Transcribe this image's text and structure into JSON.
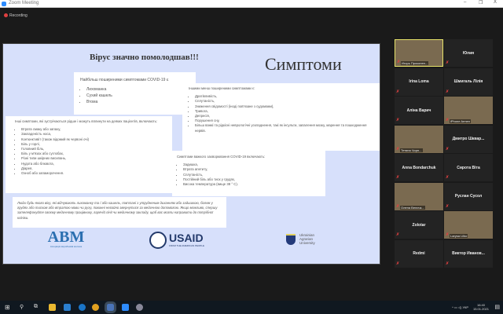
{
  "window": {
    "title": "Zoom Meeting",
    "minimize": "–",
    "restore": "❐",
    "close": "X"
  },
  "recording": "Recording",
  "slide": {
    "title": "Вірус значно помолодшав!!!",
    "heading": "Симптоми",
    "common": {
      "title": "Найбільш поширеними симптомами COVID-19 є",
      "items": [
        "Лихоманка",
        "Сухий кашель",
        "Втома"
      ]
    },
    "less_common": {
      "title": "Іншими менш поширеними симптомами є:",
      "items": [
        "Дратівливість,",
        "Сплутаність,",
        "Зниження свідомості (іноді пов'язане з судомами),",
        "Тривога,",
        "Депресія,",
        "Порушення сну,",
        "Більш важкі та рідкісні неврологічні ускладнення, такі як інсульти, запалення мозку, марення та пошкодження нервів."
      ]
    },
    "rare": {
      "title": "Інші симптоми, які зустрічаються рідше і можуть вплинути на деяких пацієнтів, включають:",
      "items": [
        "Втрата смаку або запаху,",
        "Закладеність носа,",
        "Кон'юнктивіт (також відомий як червоні очі)",
        "Біль у горлі,",
        "Головний біль,",
        "Біль у м'язах або суглобах,",
        "Різні типи шкірних висипань,",
        "Нудота або блювота,",
        "Діарея,",
        "Озноб або запаморочення."
      ]
    },
    "severe": {
      "title": "Симптоми важкого захворювання COVID-19 включають:",
      "items": [
        "Задишка,",
        "Втрата апетиту,",
        "Сплутаність,",
        "Постійний біль або тиск у грудях,",
        "Висока температура (вище 38 ° C)."
      ]
    },
    "advice": "Люди будь-якого віку, які відчувають лихоманку та / або кашель, пов'язані з утрудненим диханням або задишкою, болем у грудях або тиском або втратою мови чи руху, повинні негайно звернутися за медичною допомогою. Якщо можливо, спершу зателефонуйте своєму медичному працівнику, гарячій лінії чи медичному закладу, щоб вас могли направити до потрібної клініки.",
    "logos": {
      "abm": "АВМ",
      "abm_sub": "Асоціація виробників молока",
      "usaid": "USAID",
      "usaid_sub": "FROM THE AMERICAN PEOPLE",
      "uau": [
        "Ukrainian",
        "Agrarian",
        "University"
      ]
    }
  },
  "participants": [
    {
      "name": "Игорь Проконен...",
      "video": true,
      "active": true
    },
    {
      "name": "Юлия"
    },
    {
      "name": "Irina Loma"
    },
    {
      "name": "Шмигаль Лілія"
    },
    {
      "name": "Аліна Варич"
    },
    {
      "name": "iPhone Armen",
      "video": true
    },
    {
      "name": "Тетяна Чорн...",
      "video": true
    },
    {
      "name": "Дмитро Шквар..."
    },
    {
      "name": "Anna Bondarchuk"
    },
    {
      "name": "Сирота Віта"
    },
    {
      "name": "Олена Величк...",
      "video": true
    },
    {
      "name": "Руслан Сусол"
    },
    {
      "name": "Zolotar"
    },
    {
      "name": "Larysa Lilko",
      "video": true
    },
    {
      "name": "Redmi"
    },
    {
      "name": "Виктор Иванов..."
    }
  ],
  "taskbar": {
    "lang": "УКР",
    "time": "16:40",
    "date": "15.01.2021"
  }
}
